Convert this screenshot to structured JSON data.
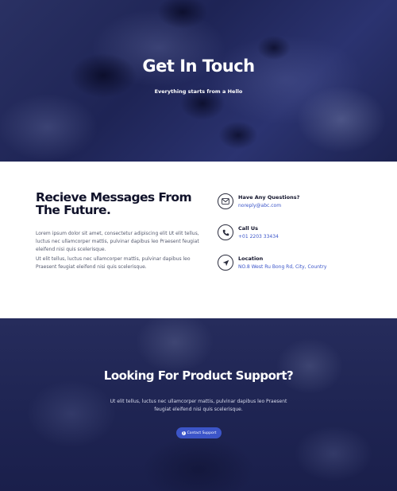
{
  "hero": {
    "title": "Get In Touch",
    "subtitle": "Everything starts from a Hello"
  },
  "messages": {
    "heading": "Recieve Messages From The Future.",
    "paragraph_1": "Lorem ipsum dolor sit amet, consectetur adipiscing elit Ut elit tellus, luctus nec ullamcorper mattis, pulvinar dapibus leo Praesent feugiat eleifend nisi quis scelerisque.",
    "paragraph_2": "Ut elit tellus, luctus nec ullamcorper mattis, pulvinar dapibus leo Praesent feugiat eleifend nisi quis scelerisque."
  },
  "contact": [
    {
      "title": "Have Any Questions?",
      "value": "noreply@abc.com",
      "icon": "mail-icon"
    },
    {
      "title": "Call Us",
      "value": "+01 2203 33434",
      "icon": "phone-icon"
    },
    {
      "title": "Location",
      "value": "NO.8 West Ru Bong Rd, City, Country",
      "icon": "location-arrow-icon"
    }
  ],
  "support": {
    "title": "Looking For Product Support?",
    "text": "Ut elit tellus, luctus nec ullamcorper mattis, pulvinar dapibus leo Praesent feugiat eleifend nisi quis scelerisque.",
    "button_label": "Contact Support",
    "button_icon": "question-circle-icon"
  },
  "colors": {
    "accent": "#3c55c8",
    "link": "#3b55c9",
    "hero_overlay": "#1e2455",
    "heading": "#10122a"
  }
}
